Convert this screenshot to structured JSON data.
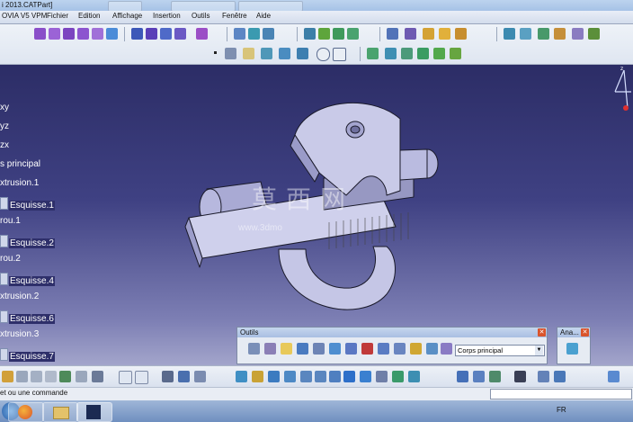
{
  "window": {
    "title": "i 2013.CATPart]",
    "app_name": "OVIA V5 VPM"
  },
  "menu": [
    {
      "label": "Fichier"
    },
    {
      "label": "Edition"
    },
    {
      "label": "Affichage"
    },
    {
      "label": "Insertion"
    },
    {
      "label": "Outils"
    },
    {
      "label": "Fenêtre"
    },
    {
      "label": "Aide"
    }
  ],
  "tree": {
    "items": [
      {
        "label": "xy"
      },
      {
        "label": "yz"
      },
      {
        "label": "zx"
      },
      {
        "label": "s principal"
      },
      {
        "label": "xtrusion.1"
      },
      {
        "label": "Esquisse.1"
      },
      {
        "label": "rou.1"
      },
      {
        "label": "Esquisse.2"
      },
      {
        "label": "rou.2"
      },
      {
        "label": "Esquisse.4"
      },
      {
        "label": "xtrusion.2"
      },
      {
        "label": "Esquisse.6"
      },
      {
        "label": "xtrusion.3"
      },
      {
        "label": "Esquisse.7"
      }
    ]
  },
  "outils_toolbar": {
    "title": "Outils",
    "body_select_value": "Corps principal"
  },
  "ana_toolbar": {
    "title": "Ana..."
  },
  "status": {
    "prompt": "et ou une commande"
  },
  "taskbar": {
    "language": "FR"
  },
  "watermark": {
    "text": "莫西网",
    "url": "www.3dmo"
  },
  "colors": {
    "viewport_top": "#2c2d66",
    "viewport_bottom": "#a3a5cb",
    "part_fill": "#c8c9e6",
    "part_stroke": "#1a1a2a"
  }
}
